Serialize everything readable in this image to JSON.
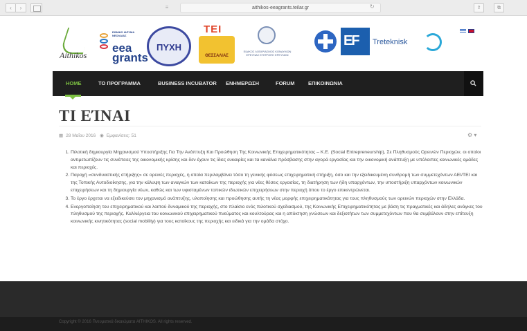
{
  "browser": {
    "url": "aithikos-eeagrants.teilar.gr",
    "back_icon": "‹",
    "forward_icon": "›",
    "reload_icon": "↻",
    "reader_icon": "≡",
    "share_icon": "⇪",
    "tabs_icon": "⧉"
  },
  "logos": {
    "aithikos": "Aithikos",
    "eea_small": "ΕΘΝΙΚΟ ΙΔΡΥΜΑ ΝΕΟΛΑΙΑΣ",
    "eea_word1": "eea",
    "eea_word2": "grants",
    "pyxh": "ΠΥΧΗ",
    "teithe_top": "ΤΕΙ",
    "teithe_sub": "ΘΕΣΣΑΛΙΑΣ",
    "eer_text": "ΕΙΔΙΚΟΣ ΛΟΓΑΡΙΑΣΜΟΣ ΚΟΝΔΥΛΙΩΝ ΕΡΕΥΝΑΣ ΕΠΙΤΡΟΠΗ ΕΡΕΥΝΩΝ",
    "ef": "EF",
    "treteknisk": "Treteknisk"
  },
  "nav": {
    "items": [
      {
        "label": "HOME"
      },
      {
        "label": "ΤΟ ΠΡΟΓΡΑΜΜΑ"
      },
      {
        "label": "BUSINESS INCUBATOR"
      },
      {
        "label": "ΕΝΗΜΕΡΩΣΗ"
      },
      {
        "label": "FORUM"
      },
      {
        "label": "ΕΠΙΚΟΙΝΩΝΙΑ"
      }
    ],
    "search_icon": "search-icon"
  },
  "page": {
    "title": "ΤΙ ΕΊΝΑΙ",
    "date": "28 Μαΐου 2016",
    "views": "Εμφανίσεις: 51",
    "settings_icon": "⚙ ▾"
  },
  "content": {
    "items": [
      "Πιλοτική δημιουργία Μηχανισμού Υποστήριξης Για Την Ανάπτυξη Και Προώθηση Της Κοινωνικής Επιχειρηματικότητας – Κ.Ε. (Social Entrepreneurship), Σε Πληθυσμούς Ορεινών Περιοχών, οι οποίοι αντιμετωπίζουν τις συνέπειες της οικονομικής κρίσης και δεν έχουν τις ίδιες ευκαιρίες και τα κανάλια πρόσβασης στην αγορά εργασίας και την οικονομική ανάπτυξη με υπόλοιπες κοινωνικές ομάδες και περιοχές.",
      "Παροχή «συνδυαστικής στήριξης» σε ορεινές περιοχές, η οποία περιλαμβάνει τόσο τη γενικής φύσεως επιχειρηματική στήριξη, όσο και την εξειδικευμένη συνδρομή των συμμετεχόντων ΑΕΙ/ΤΕΙ και της Τοπικής Αυτοδιοίκησης, για την κάλυψη των αναγκών των κατοίκων της περιοχής για νέες θέσεις εργασίας, τη διατήρηση των ήδη υπαρχόντων, την υποστήριξη υπαρχόντων κοινωνικών επιχειρήσεων και τη δημιουργία νέων, καθώς και των υφισταμένων τοπικών ιδιωτικών επιχειρήσεων στην περιοχή όπου το έργο επικεντρώνεται.",
      "Το έργο έρχεται να εξειδικεύσει τον μηχανισμό ανάπτυξης, υλοποίησης και προώθησης αυτής τη νέας μορφής επιχειρηματικότητας για τους πληθυσμούς των ορεινών περιοχών στην Ελλάδα.",
      "Ενεργοποίηση του επιχειρηματικού και λοιπού δυναμικού της περιοχής, στο πλαίσιο ενός πιλοτικού σχεδιασμού, της Κοινωνικής Επιχειρηματικότητας με βάση τις πραγματικές και άδηλες ανάγκες του πληθυσμού της περιοχής. Καλλιέργεια του κοινωνικού επιχειρηματικού πνεύματος και κουλτούρας και η απόκτηση γνώσεων και δεξιοτήτων των συμμετεχόντων που θα συμβάλουν στην επίτευξη κοινωνικής κινητικότητας (social mobility) για τους κατοίκους της περιοχής και ειδικά για την ομάδα στόχο."
    ]
  },
  "footer": {
    "copyright": "Copyright © 2016 Πνευματικά δικαιώματα AITHIKOS. All rights reserved."
  },
  "colors": {
    "accent": "#7dc142",
    "navbar": "#1f1f1f",
    "footer": "#2a2a2a"
  }
}
